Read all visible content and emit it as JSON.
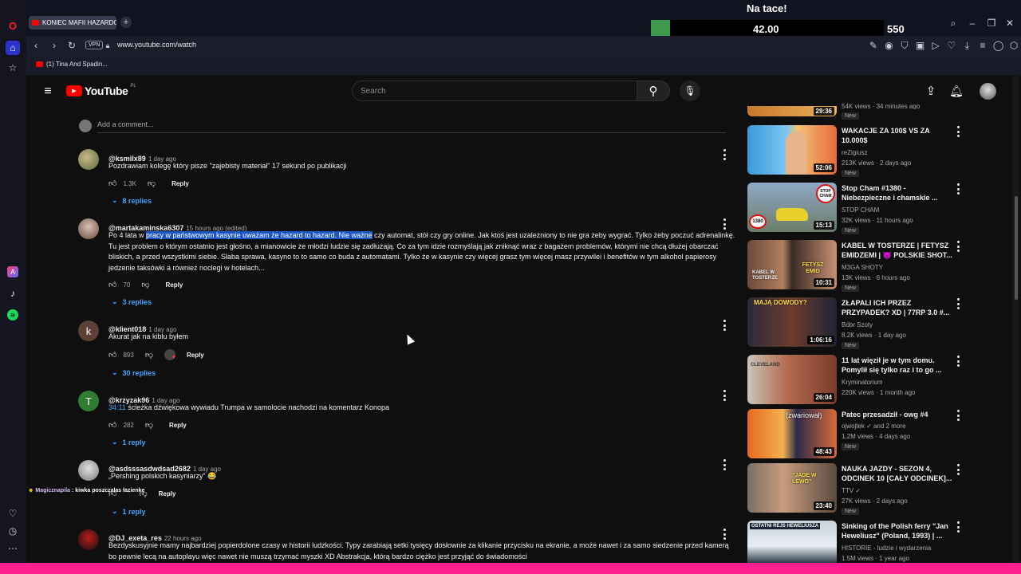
{
  "browser": {
    "tab_title": "KONIEC MAFII HAZARDO",
    "url": "www.youtube.com/watch",
    "vpn_label": "VPN",
    "bookmark": "(1) Tina And Spadin..."
  },
  "overlay": {
    "title": "Na tace!",
    "amount": "42.00",
    "score": "550"
  },
  "youtube": {
    "logo_text": "YouTube",
    "region": "PL",
    "search_placeholder": "Search"
  },
  "add_comment": "Add a comment...",
  "reply_label": "Reply",
  "comments": [
    {
      "handle": "@ksmilx89",
      "time": "1 day ago",
      "text": "Pozdrawiam kolegę który pisze \"zajebisty materiał\" 17 sekund po publikacji",
      "likes": "1.3K",
      "replies": "8 replies",
      "avatar": ""
    },
    {
      "handle": "@martakaminska6307",
      "time": "15 hours ago (edited)",
      "text_pre": "Po 4 lata w ",
      "text_highlight": "pracy w państwowym kasynie uważam że hazard to hazard. Nie ważne",
      "text_post": " czy automat, stół czy gry online. Jak ktoś jest uzależniony to nie gra żeby wygrać. Tylko żeby poczuć adrenalinkę. Tu jest problem o którym ostatnio  jest głośno, a mianowicie że młodzi ludzie się zadłużają. Co za tym idzie rozmyślają jak zniknąć wraz z bagażem problemów, którymi nie chcą dłużej obarczać bliskich, a przed wszystkimi siebie. Słaba sprawa, kasyno to to samo co buda z automatami. Tylko że w kasynie czy więcej grasz tym więcej masz  przywilei i benefitów w tym alkohol papierosy jedzenie taksówki a również noclegi w hotelach...",
      "likes": "70",
      "replies": "3 replies"
    },
    {
      "handle": "@klient018",
      "time": "1 day ago",
      "text": "Akurat jak na kiblu byłem",
      "likes": "893",
      "replies": "30 replies",
      "avatar": "k"
    },
    {
      "handle": "@krzyzak96",
      "time": "1 day ago",
      "timestamp_link": "34:11",
      "text": "ścieżka dźwiękowa wywiadu Trumpa w samolocie nachodzi na komentarz Konopa",
      "likes": "282",
      "replies": "1 reply",
      "avatar": "T"
    },
    {
      "handle": "@asdsssasdwdsad2682",
      "time": "1 day ago",
      "text": "„Pershing polskich kasyniarzy” 😂",
      "likes": "",
      "replies": "1 reply"
    },
    {
      "handle": "@DJ_exeta_res",
      "time": "22 hours ago",
      "text": "Bezdyskusyjnie mamy najbardziej popierdolone czasy w historii ludzkości. Typy zarabiają setki tysięcy dosłownie za klikanie przycisku na ekranie, a może nawet i za samo siedzenie przed kamerą bo pewnie lecą na autoplayu więc nawet nie muszą trzymać myszki XD Abstrakcja, którą bardzo ciężko jest przyjąć do świadomości"
    }
  ],
  "chat_overlay": {
    "user": "Magicznapila",
    "message": ": kiwka poszczalas łazienkę"
  },
  "recommendations": [
    {
      "title": "",
      "channel": "",
      "meta": "54K views · 34 minutes ago",
      "duration": "29:36",
      "badge": "New"
    },
    {
      "title": "WAKACJE ZA 100$ VS ZA 10.000$",
      "channel": "reZigiusz",
      "meta": "213K views · 2 days ago",
      "duration": "52:06",
      "badge": "New"
    },
    {
      "title": "Stop Cham #1380 - Niebezpieczne i chamskie ...",
      "channel": "STOP CHAM",
      "meta": "32K views · 11 hours ago",
      "duration": "15:13",
      "badge": "New"
    },
    {
      "title": "KABEL W TOSTERZE | FETYSZ EMIDZEMI | 😈 POLSKIE SHOT...",
      "channel": "M3GA SHOTY",
      "meta": "13K views · 6 hours ago",
      "duration": "10:31",
      "badge": "New"
    },
    {
      "title": "ZŁAPALI ICH PRZEZ PRZYPADEK? XD | 77RP 3.0 #...",
      "channel": "Bóbr Szoty",
      "meta": "8.2K views · 1 day ago",
      "duration": "1:06:16",
      "badge": "New"
    },
    {
      "title": "11 lat więził je w tym domu. Pomylił się tylko raz i to go ...",
      "channel": "Kryminatorium",
      "meta": "220K views · 1 month ago",
      "duration": "26:04",
      "badge": ""
    },
    {
      "title": "Patec przesadził - owg #4",
      "channel": "ojwojtek ✓ and 2 more",
      "meta": "1.2M views · 4 days ago",
      "duration": "48:43",
      "badge": "New"
    },
    {
      "title": "NAUKA JAZDY - SEZON 4, ODCINEK 10 [CAŁY ODCINEK]...",
      "channel": "TTV ✓",
      "meta": "27K views · 2 days ago",
      "duration": "23:40",
      "badge": "New"
    },
    {
      "title": "Sinking of the Polish ferry \"Jan Heweliusz\" (Poland, 1993) | ...",
      "channel": "HISTORIE - ludzie i wydarzenia",
      "meta": "1.5M views · 1 year ago",
      "duration": "",
      "badge": ""
    }
  ],
  "thumb_texts": {
    "t6": "(zwariował)",
    "t7": "\"JADE W LEWO\"",
    "t8": "OSTATNI REJS HEWELIUSZA",
    "t3": "KABEL W TOSTERZE",
    "t3b": "FETYSZ EMID",
    "t4": "MAJĄ DOWODY?",
    "t2": "STOP CHAM",
    "t2b": "1380",
    "t5": "CLEVELAND"
  }
}
